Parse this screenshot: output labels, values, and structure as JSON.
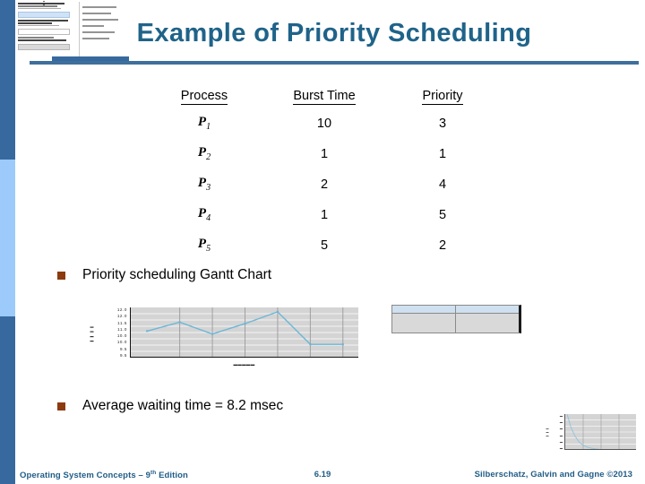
{
  "slide": {
    "title": "Example of Priority Scheduling",
    "title_color": "#1f6389",
    "rule_color": "#3f6f9b",
    "accent_dark": "#37699e",
    "accent_light": "#9ccbfb",
    "bullet_color": "#8c3b10"
  },
  "table": {
    "headers": [
      "Process",
      "Burst Time",
      "Priority"
    ],
    "rows": [
      {
        "process": "P",
        "sub": "1",
        "burst": "10",
        "priority": "3"
      },
      {
        "process": "P",
        "sub": "2",
        "burst": "1",
        "priority": "1"
      },
      {
        "process": "P",
        "sub": "3",
        "burst": "2",
        "priority": "4"
      },
      {
        "process": "P",
        "sub": "4",
        "burst": "1",
        "priority": "5"
      },
      {
        "process": "P",
        "sub": "5",
        "burst": "5",
        "priority": "2"
      }
    ]
  },
  "bullets": {
    "gantt": "Priority scheduling Gantt Chart",
    "average": "Average waiting time = 8.2 msec"
  },
  "thumbnails": {
    "doc_thumb_name": "document-thumbnail",
    "mini_table": {
      "headers": [
        "",
        ""
      ],
      "cells": [
        "",
        ""
      ]
    }
  },
  "chart_data": [
    {
      "id": "gantt-line-chart-thumb",
      "type": "line",
      "title": "",
      "xlabel": "",
      "ylabel": "",
      "x": [
        0,
        1,
        2,
        3,
        4,
        5,
        6
      ],
      "values": [
        11.0,
        11.6,
        10.8,
        11.5,
        12.3,
        10.1,
        10.1
      ],
      "yticks": [
        "12.0",
        "12.0",
        "11.5",
        "11.0",
        "10.0",
        "10.0",
        "9.5",
        "9.5"
      ],
      "xticks": [
        "",
        "",
        "",
        "",
        "",
        "",
        ""
      ],
      "ylim": [
        9.2,
        12.6
      ],
      "grid": true,
      "legend": "none",
      "line_color": "#6cb6d6",
      "plot_bg": "#d4d4d4"
    },
    {
      "id": "decay-chart-thumb",
      "type": "line",
      "title": "",
      "xlabel": "",
      "ylabel": "",
      "x": [
        0,
        1,
        2,
        3,
        4,
        5,
        6,
        7,
        8
      ],
      "values": [
        100,
        62,
        38,
        22,
        13,
        8,
        5,
        3,
        2
      ],
      "yticks": [
        "",
        "",
        "",
        "",
        "",
        ""
      ],
      "xticks": [],
      "ylim": [
        0,
        100
      ],
      "grid": true,
      "legend": "none",
      "line_color": "#8ec4dd",
      "plot_bg": "#d4d4d4"
    }
  ],
  "footer": {
    "left_main": "Operating System Concepts ",
    "left_dash": "– 9",
    "left_sup": "th",
    "left_tail": " Edition",
    "page": "6.19",
    "right": "Silberschatz, Galvin and Gagne ©2013"
  }
}
